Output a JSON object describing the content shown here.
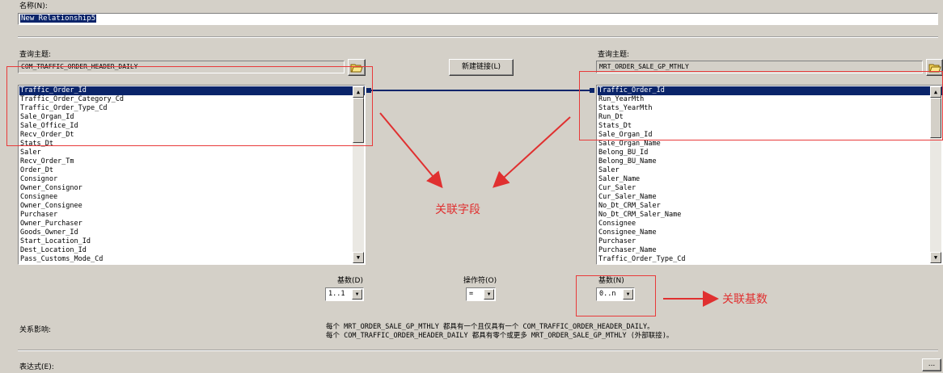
{
  "name_field": {
    "label": "名称(N):",
    "value": "New Relationship5"
  },
  "left_subject": {
    "label": "查询主题:",
    "value": "COM_TRAFFIC_ORDER_HEADER_DAILY",
    "fields": [
      "Traffic_Order_Id",
      "Traffic_Order_Category_Cd",
      "Traffic_Order_Type_Cd",
      "Sale_Organ_Id",
      "Sale_Office_Id",
      "Recv_Order_Dt",
      "Stats_Dt",
      "Saler",
      "Recv_Order_Tm",
      "Order_Dt",
      "Consignor",
      "Owner_Consignor",
      "Consignee",
      "Owner_Consignee",
      "Purchaser",
      "Owner_Purchaser",
      "Goods_Owner_Id",
      "Start_Location_Id",
      "Dest_Location_Id",
      "Pass_Customs_Mode_Cd"
    ],
    "selected": "Traffic_Order_Id"
  },
  "right_subject": {
    "label": "查询主题:",
    "value": "MRT_ORDER_SALE_GP_MTHLY",
    "fields": [
      "Traffic_Order_Id",
      "Run_YearMth",
      "Stats_YearMth",
      "Run_Dt",
      "Stats_Dt",
      "Sale_Organ_Id",
      "Sale_Organ_Name",
      "Belong_BU_Id",
      "Belong_BU_Name",
      "Saler",
      "Saler_Name",
      "Cur_Saler",
      "Cur_Saler_Name",
      "No_Dt_CRM_Saler",
      "No_Dt_CRM_Saler_Name",
      "Consignee",
      "Consignee_Name",
      "Purchaser",
      "Purchaser_Name",
      "Traffic_Order_Type_Cd"
    ],
    "selected": "Traffic_Order_Id"
  },
  "new_link_button": "新建链接(L)",
  "cardinality_left": {
    "label": "基数(D)",
    "value": "1..1"
  },
  "operator": {
    "label": "操作符(O)",
    "value": "="
  },
  "cardinality_right": {
    "label": "基数(N)",
    "value": "0..n"
  },
  "relationship_impact": {
    "label": "关系影响:",
    "line1": "每个 MRT_ORDER_SALE_GP_MTHLY 都具有一个且仅具有一个 COM_TRAFFIC_ORDER_HEADER_DAILY。",
    "line2": "每个 COM_TRAFFIC_ORDER_HEADER_DAILY 都具有零个或更多 MRT_ORDER_SALE_GP_MTHLY (外部联接)。"
  },
  "expression": {
    "label": "表达式(E):",
    "button": "..."
  },
  "annotations": {
    "link_fields": "关联字段",
    "link_cardinality": "关联基数",
    "color": "#e03030"
  },
  "colors": {
    "dialog_bg": "#d4d0c8",
    "selection": "#0a246a",
    "link_line": "#0a246a"
  }
}
